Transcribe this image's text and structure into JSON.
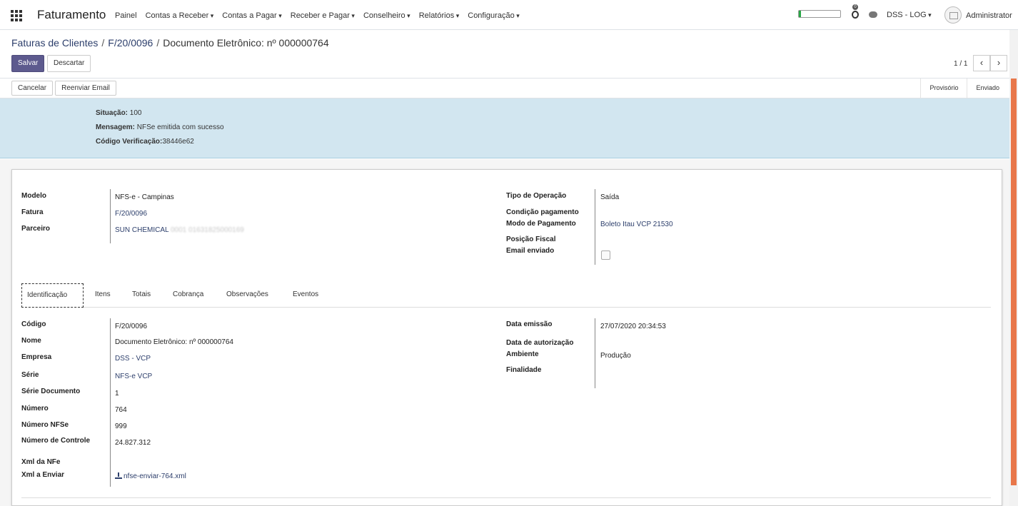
{
  "navbar": {
    "app_title": "Faturamento",
    "menu": [
      {
        "label": "Painel",
        "dropdown": false
      },
      {
        "label": "Contas a Receber",
        "dropdown": true
      },
      {
        "label": "Contas a Pagar",
        "dropdown": true
      },
      {
        "label": "Receber e Pagar",
        "dropdown": true
      },
      {
        "label": "Conselheiro",
        "dropdown": true
      },
      {
        "label": "Relatórios",
        "dropdown": true
      },
      {
        "label": "Configuração",
        "dropdown": true
      }
    ],
    "progress_fraction": 0.05,
    "progress_color": "#28a745",
    "activity_count": "0",
    "company": "DSS - LOG",
    "user": "Administrator"
  },
  "breadcrumb": {
    "items": [
      "Faturas de Clientes",
      "F/20/0096",
      "Documento Eletrônico: nº 000000764"
    ],
    "separator": "/"
  },
  "buttons": {
    "save": "Salvar",
    "discard": "Descartar",
    "cancel": "Cancelar",
    "resend_email": "Reenviar Email"
  },
  "pager": {
    "value": "1 / 1",
    "prev": "‹",
    "next": "›"
  },
  "status_steps": [
    "Provisório",
    "Enviado"
  ],
  "alert": {
    "situacao_label": "Situação:",
    "situacao_value": "100",
    "mensagem_label": "Mensagem:",
    "mensagem_value": "NFSe emitida com sucesso",
    "codigo_label": "Código Verificação:",
    "codigo_value": "38446e62"
  },
  "header_fields": {
    "left": [
      {
        "label": "Modelo",
        "value": "NFS-e - Campinas"
      },
      {
        "label": "Fatura",
        "value": "F/20/0096"
      },
      {
        "label": "Parceiro",
        "value": "SUN CHEMICAL",
        "blurred": "0001 01631825000169"
      }
    ],
    "right": [
      {
        "label": "Tipo de Operação",
        "value": "Saída"
      },
      {
        "label": "Condição pagamento",
        "value": ""
      },
      {
        "label": "Modo de Pagamento",
        "value": "Boleto Itau VCP 21530"
      },
      {
        "label": "Posição Fiscal",
        "value": ""
      },
      {
        "label": "Email enviado",
        "checked": false
      }
    ]
  },
  "tabs": [
    "Identificação",
    "Itens",
    "Totais",
    "Cobrança",
    "Observações",
    "Eventos"
  ],
  "identificacao": {
    "left": [
      {
        "label": "Código",
        "value": "F/20/0096"
      },
      {
        "label": "Nome",
        "value": "Documento Eletrônico: nº 000000764"
      },
      {
        "label": "Empresa",
        "value": "DSS - VCP"
      },
      {
        "label": "Série",
        "value": "NFS-e VCP"
      },
      {
        "label": "Série Documento",
        "value": "1"
      },
      {
        "label": "Número",
        "value": "764"
      },
      {
        "label": "Número NFSe",
        "value": "999"
      },
      {
        "label": "Número de Controle",
        "value": "24.827.312"
      },
      {
        "label": "Xml da NFe",
        "value": ""
      },
      {
        "label": "Xml a Enviar",
        "value": "nfse-enviar-764.xml"
      }
    ],
    "right": [
      {
        "label": "Data emissão",
        "value": "27/07/2020 20:34:53"
      },
      {
        "label": "Data de autorização",
        "value": ""
      },
      {
        "label": "Ambiente",
        "value": "Produção"
      },
      {
        "label": "Finalidade",
        "value": ""
      }
    ]
  }
}
